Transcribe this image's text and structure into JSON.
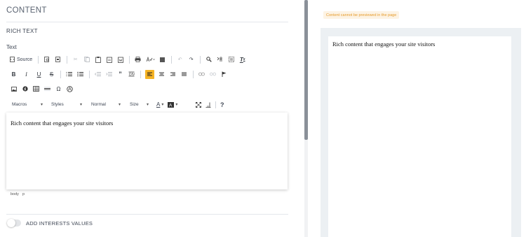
{
  "panel": {
    "title": "CONTENT",
    "subtitle": "RICH TEXT",
    "field_label": "Text"
  },
  "toolbar": {
    "source_label": "Source",
    "combos": {
      "macros": "Macros",
      "styles": "Styles",
      "format": "Normal",
      "size": "Size"
    },
    "help_label": "?",
    "active_color": "#f5b324",
    "icons_row1": [
      "source-icon",
      "preview-icon",
      "templates-icon",
      "cut-icon",
      "copy-icon",
      "paste-icon",
      "paste-text-icon",
      "paste-word-icon",
      "print-icon",
      "spellcheck-icon",
      "anchor-icon",
      "undo-icon",
      "redo-icon",
      "find-icon",
      "replace-icon",
      "select-all-icon",
      "remove-format-icon"
    ],
    "icons_row2": [
      "bold-icon",
      "italic-icon",
      "underline-icon",
      "strike-icon",
      "numbered-list-icon",
      "bullet-list-icon",
      "outdent-icon",
      "indent-icon",
      "blockquote-icon",
      "div-icon",
      "align-left-icon",
      "align-center-icon",
      "align-right-icon",
      "justify-icon",
      "link-icon",
      "unlink-icon",
      "flag-icon"
    ],
    "icons_row3": [
      "image-icon",
      "flash-icon",
      "table-icon",
      "hr-icon",
      "special-char-icon",
      "iframe-icon"
    ]
  },
  "editor": {
    "content": "Rich content that engages your site visitors",
    "path": [
      "body",
      "p"
    ]
  },
  "interests": {
    "toggle_label": "ADD INTERESTS VALUES",
    "enabled": false
  },
  "preview": {
    "notice": "Content cannot be previewed in the page",
    "content": "Rich content that engages your site visitors"
  }
}
